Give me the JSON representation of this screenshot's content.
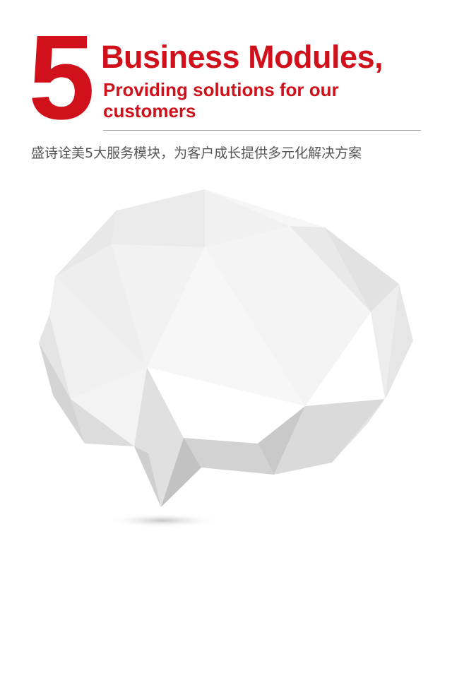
{
  "header": {
    "number": "5",
    "title": "Business Modules,",
    "subtitle": "Providing solutions for our customers"
  },
  "description": "盛诗诠美5大服务模块，为客户成长提供多元化解决方案",
  "colors": {
    "accent": "#d0111b",
    "divider": "#9a9a9a",
    "text_gray": "#555555"
  },
  "graphic": {
    "icon": "low-poly-speech-bubble-icon"
  }
}
